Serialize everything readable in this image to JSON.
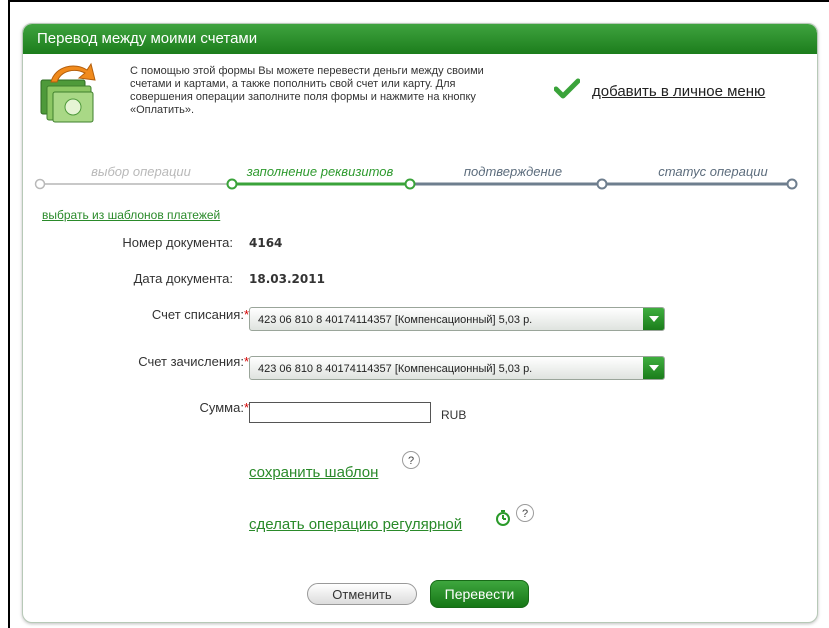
{
  "header": {
    "title": "Перевод между моими счетами"
  },
  "intro": {
    "line1": "С помощью этой формы Вы можете перевести деньги между своими",
    "line2": "счетами и картами, а также пополнить свой счет или карту. Для",
    "line3": "совершения операции заполните поля формы и нажмите на кнопку",
    "line4": "«Оплатить».",
    "add_to_menu": "добавить в личное меню",
    "icon": "money-transfer-icon"
  },
  "steps": [
    {
      "label": "выбор операции",
      "state": "done"
    },
    {
      "label": "заполнение реквизитов",
      "state": "active"
    },
    {
      "label": "подтверждение",
      "state": "pending"
    },
    {
      "label": "статус операции",
      "state": "pending"
    }
  ],
  "templates_link": "выбрать из шаблонов платежей",
  "form": {
    "doc_number_label": "Номер документа:",
    "doc_number": "4164",
    "doc_date_label": "Дата документа:",
    "doc_date": "18.03.2011",
    "from_label": "Счет списания:",
    "from_value": "423 06 810 8 40174114357  [Компенсационный] 5,03  р.",
    "to_label": "Счет зачисления:",
    "to_value": "423 06 810 8 40174114357  [Компенсационный] 5,03  р.",
    "amount_label": "Сумма:",
    "amount_value": "",
    "currency": "RUB",
    "required_mark": "*"
  },
  "links": {
    "save_template": "сохранить шаблон",
    "make_regular": "сделать операцию регулярной",
    "help": "?"
  },
  "buttons": {
    "cancel": "Отменить",
    "submit": "Перевести"
  },
  "colors": {
    "accent": "#2a8a2a",
    "header": "#1c7d1c",
    "required": "#d40000"
  }
}
